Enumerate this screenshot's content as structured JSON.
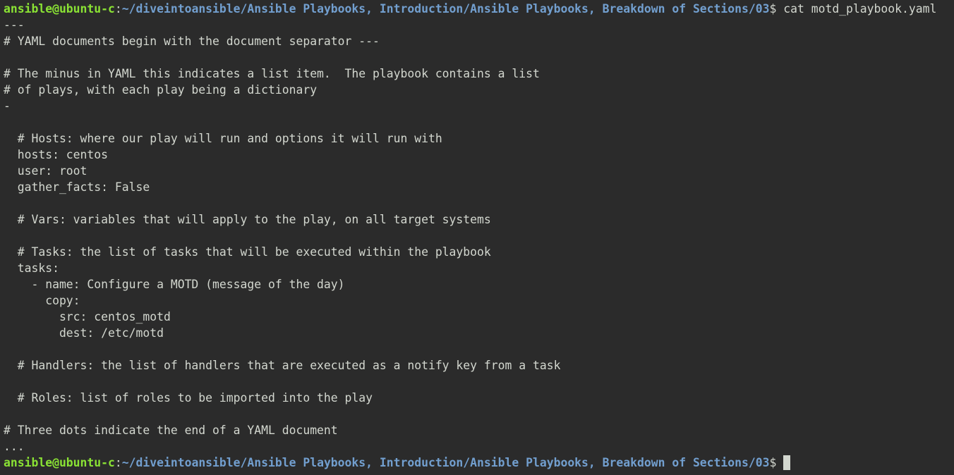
{
  "colors": {
    "background": "#2b2b2b",
    "text": "#d3d7cf",
    "prompt_user": "#8ae234",
    "prompt_path": "#729fcf"
  },
  "prompt": {
    "user_host": "ansible@ubuntu-c",
    "colon": ":",
    "path": "~/diveintoansible/Ansible Playbooks, Introduction/Ansible Playbooks, Breakdown of Sections/03",
    "symbol": "$"
  },
  "command": " cat motd_playbook.yaml",
  "output_lines": [
    "---",
    "# YAML documents begin with the document separator ---",
    "",
    "# The minus in YAML this indicates a list item.  The playbook contains a list",
    "# of plays, with each play being a dictionary",
    "-",
    "",
    "  # Hosts: where our play will run and options it will run with",
    "  hosts: centos",
    "  user: root",
    "  gather_facts: False",
    "",
    "  # Vars: variables that will apply to the play, on all target systems",
    "",
    "  # Tasks: the list of tasks that will be executed within the playbook",
    "  tasks:",
    "    - name: Configure a MOTD (message of the day)",
    "      copy:",
    "        src: centos_motd",
    "        dest: /etc/motd",
    "",
    "  # Handlers: the list of handlers that are executed as a notify key from a task",
    "",
    "  # Roles: list of roles to be imported into the play",
    "",
    "# Three dots indicate the end of a YAML document",
    "..."
  ]
}
